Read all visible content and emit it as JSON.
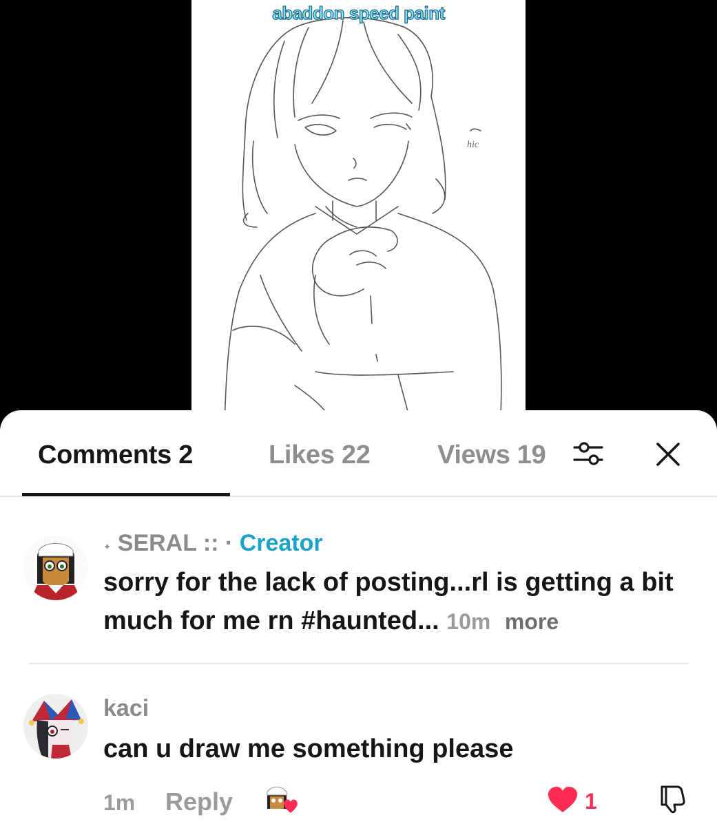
{
  "video": {
    "title": "abaddon speed paint",
    "sketch_note": "hic"
  },
  "tabs": [
    {
      "label": "Comments 2",
      "active": true
    },
    {
      "label": "Likes 22",
      "active": false
    },
    {
      "label": "Views 19",
      "active": false
    }
  ],
  "header_icons": [
    "filter-icon",
    "close-icon"
  ],
  "comments": [
    {
      "author_prefix": "˖ SERAL :: ·",
      "author_badge": "Creator",
      "text": "sorry for the lack of posting...rl is getting a bit much for me rn #haunted...",
      "time": "10m",
      "more_label": "more"
    },
    {
      "author": "kaci",
      "text": "can u draw me something please",
      "time": "1m",
      "reply_label": "Reply",
      "like_count": "1"
    }
  ],
  "colors": {
    "accent_creator": "#1aa3c9",
    "like_red": "#ff2d55",
    "title_fill": "#7fe4f0",
    "title_stroke": "#1c5f86"
  }
}
